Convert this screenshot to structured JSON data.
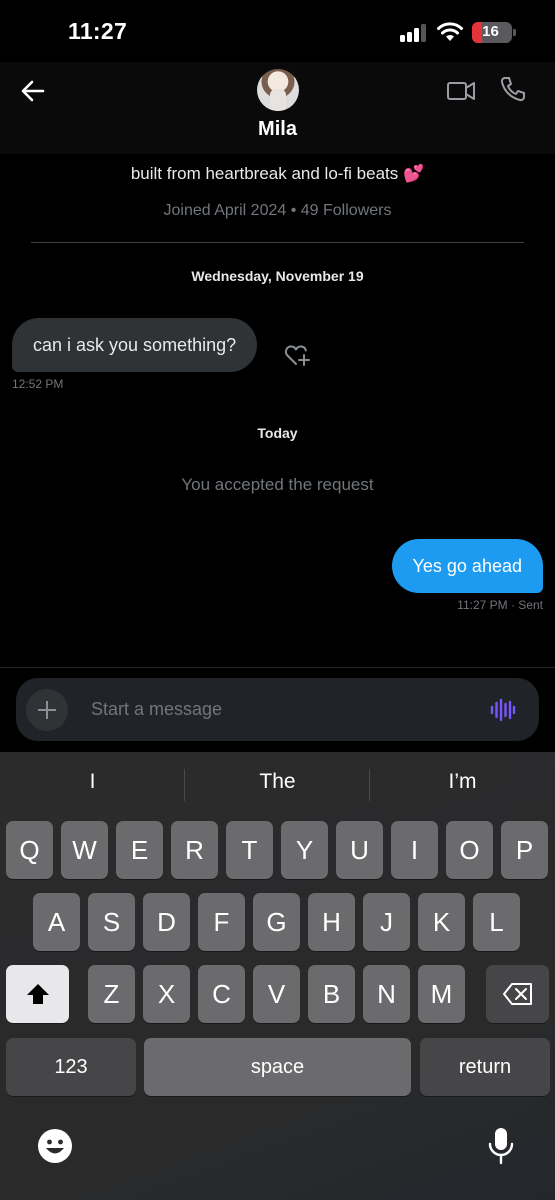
{
  "status_bar": {
    "time": "11:27",
    "battery": "16",
    "battery_color": "#e5333a"
  },
  "header": {
    "name": "Mila",
    "back_icon": "arrow-left-icon",
    "video_icon": "video-camera-icon",
    "call_icon": "phone-icon"
  },
  "profile": {
    "bio": "built from heartbreak and lo-fi beats 💕",
    "joined": "Joined April 2024 • 49 Followers"
  },
  "messages": {
    "date_1": "Wednesday, November 19",
    "incoming": {
      "text": "can i ask you something?",
      "time": "12:52 PM"
    },
    "date_2": "Today",
    "system": "You accepted the request",
    "outgoing": {
      "text": "Yes go ahead",
      "status": "11:27 PM · Sent"
    }
  },
  "composer": {
    "placeholder": "Start a message",
    "accent": "#7856ff"
  },
  "keyboard": {
    "suggestions": [
      "I",
      "The",
      "I’m"
    ],
    "row1": [
      "Q",
      "W",
      "E",
      "R",
      "T",
      "Y",
      "U",
      "I",
      "O",
      "P"
    ],
    "row2": [
      "A",
      "S",
      "D",
      "F",
      "G",
      "H",
      "J",
      "K",
      "L"
    ],
    "row3": [
      "Z",
      "X",
      "C",
      "V",
      "B",
      "N",
      "M"
    ],
    "numbers_label": "123",
    "space_label": "space",
    "return_label": "return"
  },
  "colors": {
    "accent_blue": "#1d9bf0",
    "background": "#000000"
  }
}
